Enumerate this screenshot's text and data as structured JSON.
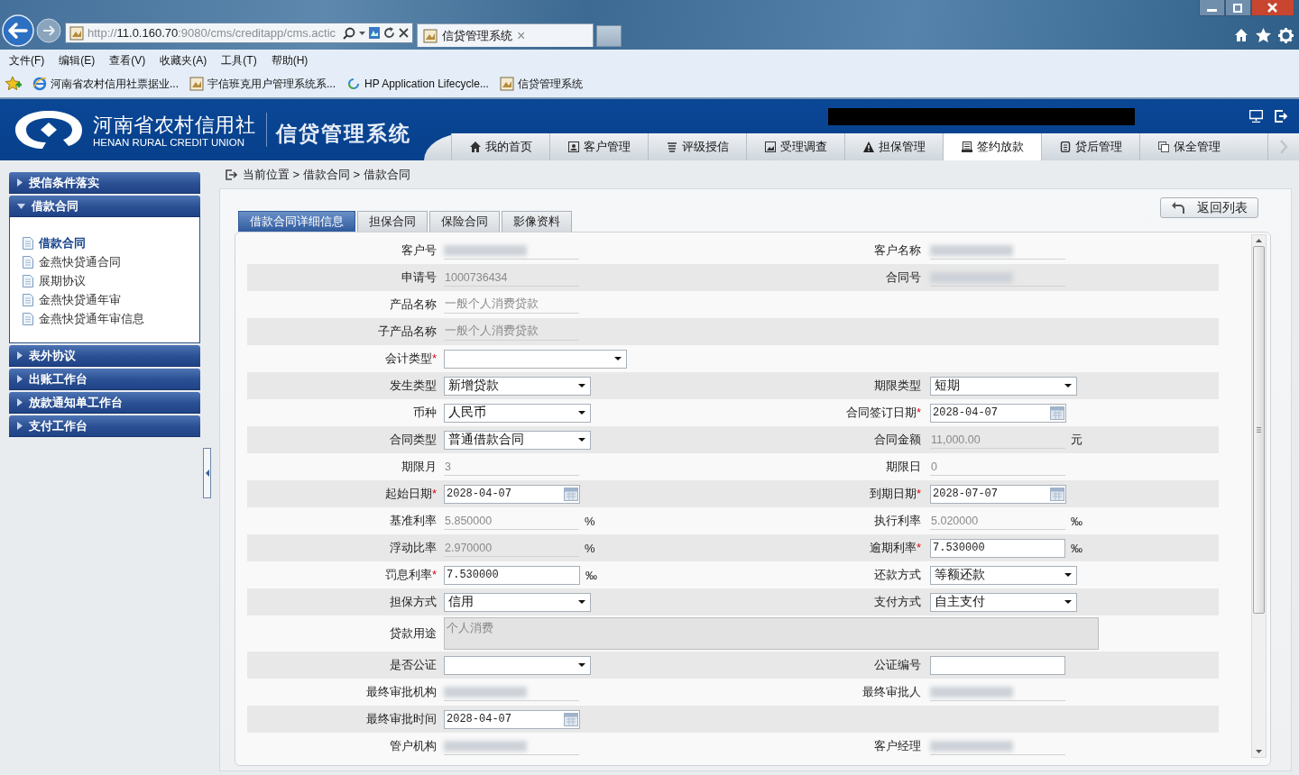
{
  "browser": {
    "url": {
      "scheme": "http://",
      "host": "11.0.160.70",
      "rest": ":9080/cms/creditapp/cms.actic"
    },
    "tabs": [
      {
        "title": "信贷管理系统",
        "close": "×"
      }
    ],
    "menu": [
      "文件(F)",
      "编辑(E)",
      "查看(V)",
      "收藏夹(A)",
      "工具(T)",
      "帮助(H)"
    ],
    "favorites": [
      {
        "label": "河南省农村信用社票据业...",
        "kind": "ie"
      },
      {
        "label": "宇信班克用户管理系统系...",
        "kind": "page"
      },
      {
        "label": "HP Application Lifecycle...",
        "kind": "hp"
      },
      {
        "label": "信贷管理系统",
        "kind": "page"
      }
    ]
  },
  "header": {
    "org_name": "河南省农村信用社",
    "org_name_en": "HENAN RURAL CREDIT UNION",
    "system_name": "信贷管理系统",
    "user_info": {
      "kind": "redacted"
    },
    "nav": [
      {
        "label": "我的首页",
        "selected": false
      },
      {
        "label": "客户管理",
        "selected": false
      },
      {
        "label": "评级授信",
        "selected": false
      },
      {
        "label": "受理调查",
        "selected": false
      },
      {
        "label": "担保管理",
        "selected": false
      },
      {
        "label": "签约放款",
        "selected": true
      },
      {
        "label": "贷后管理",
        "selected": false
      },
      {
        "label": "保全管理",
        "selected": false
      }
    ]
  },
  "sidebar": {
    "sections": [
      {
        "title": "授信条件落实",
        "expanded": false
      },
      {
        "title": "借款合同",
        "expanded": true,
        "items": [
          {
            "label": "借款合同",
            "selected": true
          },
          {
            "label": "金燕快贷通合同",
            "selected": false
          },
          {
            "label": "展期协议",
            "selected": false
          },
          {
            "label": "金燕快贷通年审",
            "selected": false
          },
          {
            "label": "金燕快贷通年审信息",
            "selected": false
          }
        ]
      },
      {
        "title": "表外协议",
        "expanded": false
      },
      {
        "title": "出账工作台",
        "expanded": false
      },
      {
        "title": "放款通知单工作台",
        "expanded": false
      },
      {
        "title": "支付工作台",
        "expanded": false
      }
    ]
  },
  "breadcrumb": "当前位置 > 借款合同 > 借款合同",
  "subtabs": [
    {
      "label": "借款合同详细信息",
      "selected": true
    },
    {
      "label": "担保合同",
      "selected": false
    },
    {
      "label": "保险合同",
      "selected": false
    },
    {
      "label": "影像资料",
      "selected": false
    }
  ],
  "return_button": "返回列表",
  "form": {
    "rows": [
      {
        "left": {
          "label": "客户号",
          "kind": "redacted"
        },
        "right": {
          "label": "客户名称",
          "kind": "redacted"
        }
      },
      {
        "left": {
          "label": "申请号",
          "kind": "readonly",
          "value": "1000736434"
        },
        "right": {
          "label": "合同号",
          "kind": "redacted"
        }
      },
      {
        "left": {
          "label": "产品名称",
          "kind": "readonly",
          "value": "一般个人消费贷款"
        }
      },
      {
        "left": {
          "label": "子产品名称",
          "kind": "readonly",
          "value": "一般个人消费贷款"
        }
      },
      {
        "left": {
          "label": "会计类型",
          "required_mark": "*",
          "kind": "select"
        }
      },
      {
        "left": {
          "label": "发生类型",
          "kind": "select",
          "value": "新增贷款"
        },
        "right": {
          "label": "期限类型",
          "kind": "select",
          "value": "短期"
        }
      },
      {
        "left": {
          "label": "币种",
          "kind": "select",
          "value": "人民币"
        },
        "right": {
          "label": "合同签订日期",
          "required_mark": "*",
          "kind": "date",
          "value": "2028-04-07"
        }
      },
      {
        "left": {
          "label": "合同类型",
          "kind": "select",
          "value": "普通借款合同"
        },
        "right": {
          "label": "合同金额",
          "kind": "readonly",
          "value": "11,000.00",
          "unit": "元"
        }
      },
      {
        "left": {
          "label": "期限月",
          "kind": "readonly",
          "value": "3"
        },
        "right": {
          "label": "期限日",
          "kind": "readonly",
          "value": "0"
        }
      },
      {
        "left": {
          "label": "起始日期",
          "required_mark": "*",
          "kind": "date",
          "value": "2028-04-07"
        },
        "right": {
          "label": "到期日期",
          "required_mark": "*",
          "kind": "date",
          "value": "2028-07-07"
        }
      },
      {
        "left": {
          "label": "基准利率",
          "kind": "readonly",
          "value": "5.850000",
          "unit": "%"
        },
        "right": {
          "label": "执行利率",
          "kind": "readonly",
          "value": "5.020000",
          "unit": "‰"
        }
      },
      {
        "left": {
          "label": "浮动比率",
          "kind": "readonly",
          "value": "2.970000",
          "unit": "%"
        },
        "right": {
          "label": "逾期利率",
          "required_mark": "*",
          "kind": "input",
          "value": "7.530000",
          "unit": "‰"
        }
      },
      {
        "left": {
          "label": "罚息利率",
          "required_mark": "*",
          "kind": "input",
          "value": "7.530000",
          "unit": "‰"
        },
        "right": {
          "label": "还款方式",
          "kind": "select",
          "value": "等额还款"
        }
      },
      {
        "left": {
          "label": "担保方式",
          "kind": "select",
          "value": "信用"
        },
        "right": {
          "label": "支付方式",
          "kind": "select",
          "value": "自主支付"
        }
      },
      {
        "left": {
          "label": "贷款用途",
          "kind": "textarea",
          "value": "个人消费"
        }
      },
      {
        "left": {
          "label": "是否公证",
          "kind": "select"
        },
        "right": {
          "label": "公证编号",
          "kind": "input"
        }
      },
      {
        "left": {
          "label": "最终审批机构",
          "kind": "redacted"
        },
        "right": {
          "label": "最终审批人",
          "kind": "redacted"
        }
      },
      {
        "left": {
          "label": "最终审批时间",
          "kind": "date",
          "value": "2028-04-07"
        }
      },
      {
        "left": {
          "label": "管户机构",
          "kind": "redacted"
        },
        "right": {
          "label": "客户经理",
          "kind": "redacted"
        }
      }
    ]
  }
}
